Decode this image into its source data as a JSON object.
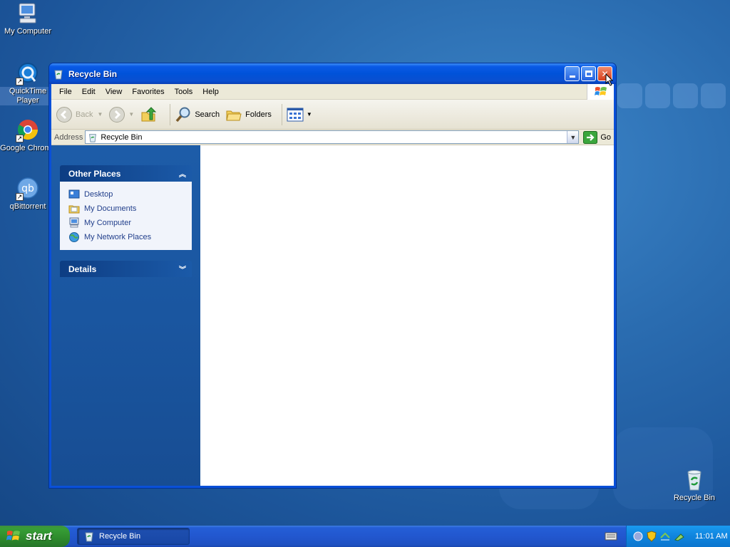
{
  "desktop": {
    "icons": [
      {
        "label": "My Computer"
      },
      {
        "label": "QuickTime Player"
      },
      {
        "label": "Google Chrome"
      },
      {
        "label": "qBittorrent"
      },
      {
        "label": "Recycle Bin"
      }
    ]
  },
  "window": {
    "title": "Recycle Bin",
    "menu": [
      "File",
      "Edit",
      "View",
      "Favorites",
      "Tools",
      "Help"
    ],
    "toolbar": {
      "back_label": "Back",
      "search_label": "Search",
      "folders_label": "Folders"
    },
    "address": {
      "label": "Address",
      "value": "Recycle Bin",
      "go_label": "Go"
    },
    "tasks": {
      "other_places": {
        "title": "Other Places",
        "links": [
          "Desktop",
          "My Documents",
          "My Computer",
          "My Network Places"
        ]
      },
      "details": {
        "title": "Details"
      }
    }
  },
  "taskbar": {
    "start_label": "start",
    "items": [
      {
        "label": "Recycle Bin"
      }
    ],
    "clock": "11:01 AM"
  }
}
